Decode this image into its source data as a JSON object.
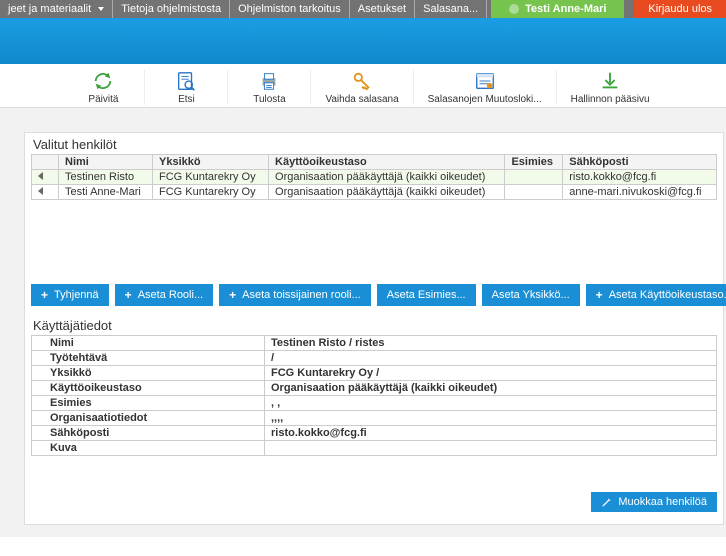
{
  "menu": {
    "items": [
      "jeet ja materiaalit",
      "Tietoja ohjelmistosta",
      "Ohjelmiston tarkoitus",
      "Asetukset",
      "Salasana..."
    ],
    "has_caret": [
      true,
      false,
      false,
      false,
      false
    ],
    "user": "Testi Anne-Mari",
    "logout": "Kirjaudu ulos"
  },
  "toolbar": [
    {
      "label": "Päivitä",
      "icon": "refresh-icon"
    },
    {
      "label": "Etsi",
      "icon": "search-icon"
    },
    {
      "label": "Tulosta",
      "icon": "print-icon"
    },
    {
      "label": "Vaihda salasana",
      "icon": "key-icon"
    },
    {
      "label": "Salasanojen Muutosloki...",
      "icon": "log-icon"
    },
    {
      "label": "Hallinnon pääsivu",
      "icon": "download-icon"
    }
  ],
  "selected": {
    "title": "Valitut henkilöt",
    "columns": [
      "Nimi",
      "Yksikkö",
      "Käyttöoikeustaso",
      "Esimies",
      "Sähköposti"
    ],
    "rows": [
      {
        "nimi": "Testinen Risto",
        "yksikko": "FCG Kuntarekry Oy",
        "taso": "Organisaation pääkäyttäjä (kaikki oikeudet)",
        "esimies": "",
        "email": "risto.kokko@fcg.fi",
        "highlight": true
      },
      {
        "nimi": "Testi Anne-Mari",
        "yksikko": "FCG Kuntarekry Oy",
        "taso": "Organisaation pääkäyttäjä (kaikki oikeudet)",
        "esimies": "",
        "email": "anne-mari.nivukoski@fcg.fi",
        "highlight": false
      }
    ]
  },
  "actions": [
    "Tyhjennä",
    "Aseta Rooli...",
    "Aseta toissijainen rooli...",
    "Aseta Esimies...",
    "Aseta Yksikkö...",
    "Aseta Käyttöoikeustaso..."
  ],
  "details": {
    "title": "Käyttäjätiedot",
    "rows": [
      {
        "key": "Nimi",
        "value": "Testinen Risto / ristes"
      },
      {
        "key": "Työtehtävä",
        "value": "/"
      },
      {
        "key": "Yksikkö",
        "value": "FCG Kuntarekry Oy /"
      },
      {
        "key": "Käyttöoikeustaso",
        "value": "Organisaation pääkäyttäjä (kaikki oikeudet)"
      },
      {
        "key": "Esimies",
        "value": ", ,"
      },
      {
        "key": "Organisaatiotiedot",
        "value": ",,,,"
      },
      {
        "key": "Sähköposti",
        "value": "risto.kokko@fcg.fi"
      },
      {
        "key": "Kuva",
        "value": ""
      }
    ]
  },
  "footer": {
    "edit": "Muokkaa henkilöä"
  },
  "icon_colors": {
    "refresh": "#3aa23a",
    "search": "#2874c6",
    "print": "#2874c6",
    "key": "#e3941d",
    "log": "#2874c6",
    "download": "#3aa23a"
  }
}
